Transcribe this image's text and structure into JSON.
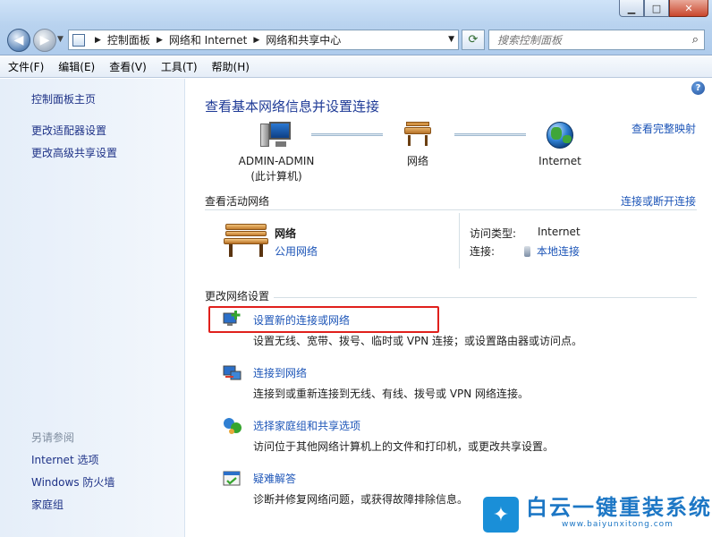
{
  "window": {
    "minimize_glyph": "▁",
    "maximize_glyph": "□",
    "close_glyph": "✕"
  },
  "address_bar": {
    "segments": [
      "控制面板",
      "网络和 Internet",
      "网络和共享中心"
    ]
  },
  "search": {
    "placeholder": "搜索控制面板"
  },
  "menu": [
    "文件(F)",
    "编辑(E)",
    "查看(V)",
    "工具(T)",
    "帮助(H)"
  ],
  "sidebar": {
    "items": [
      "控制面板主页",
      "更改适配器设置",
      "更改高级共享设置"
    ],
    "see_also_label": "另请参阅",
    "see_also": [
      "Internet 选项",
      "Windows 防火墙",
      "家庭组"
    ]
  },
  "main": {
    "heading": "查看基本网络信息并设置连接",
    "full_map_link": "查看完整映射",
    "map": {
      "computer_name": "ADMIN-ADMIN",
      "computer_sub": "(此计算机)",
      "network": "网络",
      "internet": "Internet"
    },
    "active_networks": {
      "label": "查看活动网络",
      "connect_link": "连接或断开连接",
      "network_name": "网络",
      "network_type": "公用网络",
      "access_type_label": "访问类型:",
      "access_type_value": "Internet",
      "connections_label": "连接:",
      "connections_value": "本地连接"
    },
    "change_settings": {
      "label": "更改网络设置",
      "tasks": [
        {
          "title": "设置新的连接或网络",
          "desc": "设置无线、宽带、拨号、临时或 VPN 连接；或设置路由器或访问点。",
          "icon": "new-connection-icon"
        },
        {
          "title": "连接到网络",
          "desc": "连接到或重新连接到无线、有线、拨号或 VPN 网络连接。",
          "icon": "connect-network-icon"
        },
        {
          "title": "选择家庭组和共享选项",
          "desc": "访问位于其他网络计算机上的文件和打印机，或更改共享设置。",
          "icon": "homegroup-icon"
        },
        {
          "title": "疑难解答",
          "desc": "诊断并修复网络问题，或获得故障排除信息。",
          "icon": "troubleshoot-icon"
        }
      ]
    }
  },
  "watermark": {
    "text": "白云一键重装系统",
    "url": "www.baiyunxitong.com"
  },
  "colors": {
    "link": "#1e56b8",
    "heading": "#1e3a96",
    "highlight": "#e0201c"
  }
}
